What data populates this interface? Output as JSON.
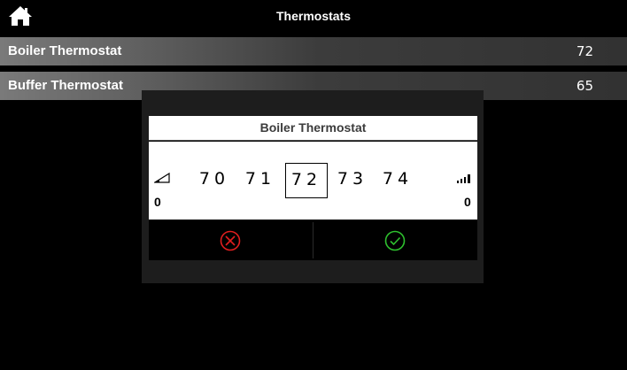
{
  "header": {
    "title": "Thermostats",
    "home_icon": "home-icon"
  },
  "list": {
    "items": [
      {
        "label": "Boiler Thermostat",
        "value": "72"
      },
      {
        "label": "Buffer Thermostat",
        "value": "65"
      }
    ]
  },
  "dialog": {
    "title": "Boiler Thermostat",
    "values": [
      "70",
      "71",
      "72",
      "73",
      "74"
    ],
    "selected": "72",
    "min_label": "0",
    "max_label": "0",
    "cancel_icon": "cancel-circle-icon",
    "confirm_icon": "confirm-check-icon",
    "colors": {
      "cancel": "#e01e1e",
      "confirm": "#2ec02e"
    }
  }
}
